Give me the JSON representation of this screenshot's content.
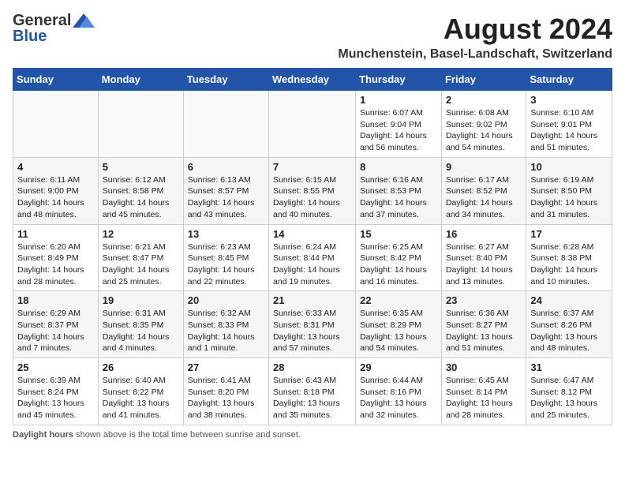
{
  "logo": {
    "general": "General",
    "blue": "Blue"
  },
  "title": "August 2024",
  "location": "Munchenstein, Basel-Landschaft, Switzerland",
  "days_of_week": [
    "Sunday",
    "Monday",
    "Tuesday",
    "Wednesday",
    "Thursday",
    "Friday",
    "Saturday"
  ],
  "footer": "Daylight hours",
  "weeks": [
    [
      {
        "day": "",
        "info": ""
      },
      {
        "day": "",
        "info": ""
      },
      {
        "day": "",
        "info": ""
      },
      {
        "day": "",
        "info": ""
      },
      {
        "day": "1",
        "info": "Sunrise: 6:07 AM\nSunset: 9:04 PM\nDaylight: 14 hours\nand 56 minutes."
      },
      {
        "day": "2",
        "info": "Sunrise: 6:08 AM\nSunset: 9:02 PM\nDaylight: 14 hours\nand 54 minutes."
      },
      {
        "day": "3",
        "info": "Sunrise: 6:10 AM\nSunset: 9:01 PM\nDaylight: 14 hours\nand 51 minutes."
      }
    ],
    [
      {
        "day": "4",
        "info": "Sunrise: 6:11 AM\nSunset: 9:00 PM\nDaylight: 14 hours\nand 48 minutes."
      },
      {
        "day": "5",
        "info": "Sunrise: 6:12 AM\nSunset: 8:58 PM\nDaylight: 14 hours\nand 45 minutes."
      },
      {
        "day": "6",
        "info": "Sunrise: 6:13 AM\nSunset: 8:57 PM\nDaylight: 14 hours\nand 43 minutes."
      },
      {
        "day": "7",
        "info": "Sunrise: 6:15 AM\nSunset: 8:55 PM\nDaylight: 14 hours\nand 40 minutes."
      },
      {
        "day": "8",
        "info": "Sunrise: 6:16 AM\nSunset: 8:53 PM\nDaylight: 14 hours\nand 37 minutes."
      },
      {
        "day": "9",
        "info": "Sunrise: 6:17 AM\nSunset: 8:52 PM\nDaylight: 14 hours\nand 34 minutes."
      },
      {
        "day": "10",
        "info": "Sunrise: 6:19 AM\nSunset: 8:50 PM\nDaylight: 14 hours\nand 31 minutes."
      }
    ],
    [
      {
        "day": "11",
        "info": "Sunrise: 6:20 AM\nSunset: 8:49 PM\nDaylight: 14 hours\nand 28 minutes."
      },
      {
        "day": "12",
        "info": "Sunrise: 6:21 AM\nSunset: 8:47 PM\nDaylight: 14 hours\nand 25 minutes."
      },
      {
        "day": "13",
        "info": "Sunrise: 6:23 AM\nSunset: 8:45 PM\nDaylight: 14 hours\nand 22 minutes."
      },
      {
        "day": "14",
        "info": "Sunrise: 6:24 AM\nSunset: 8:44 PM\nDaylight: 14 hours\nand 19 minutes."
      },
      {
        "day": "15",
        "info": "Sunrise: 6:25 AM\nSunset: 8:42 PM\nDaylight: 14 hours\nand 16 minutes."
      },
      {
        "day": "16",
        "info": "Sunrise: 6:27 AM\nSunset: 8:40 PM\nDaylight: 14 hours\nand 13 minutes."
      },
      {
        "day": "17",
        "info": "Sunrise: 6:28 AM\nSunset: 8:38 PM\nDaylight: 14 hours\nand 10 minutes."
      }
    ],
    [
      {
        "day": "18",
        "info": "Sunrise: 6:29 AM\nSunset: 8:37 PM\nDaylight: 14 hours\nand 7 minutes."
      },
      {
        "day": "19",
        "info": "Sunrise: 6:31 AM\nSunset: 8:35 PM\nDaylight: 14 hours\nand 4 minutes."
      },
      {
        "day": "20",
        "info": "Sunrise: 6:32 AM\nSunset: 8:33 PM\nDaylight: 14 hours\nand 1 minute."
      },
      {
        "day": "21",
        "info": "Sunrise: 6:33 AM\nSunset: 8:31 PM\nDaylight: 13 hours\nand 57 minutes."
      },
      {
        "day": "22",
        "info": "Sunrise: 6:35 AM\nSunset: 8:29 PM\nDaylight: 13 hours\nand 54 minutes."
      },
      {
        "day": "23",
        "info": "Sunrise: 6:36 AM\nSunset: 8:27 PM\nDaylight: 13 hours\nand 51 minutes."
      },
      {
        "day": "24",
        "info": "Sunrise: 6:37 AM\nSunset: 8:26 PM\nDaylight: 13 hours\nand 48 minutes."
      }
    ],
    [
      {
        "day": "25",
        "info": "Sunrise: 6:39 AM\nSunset: 8:24 PM\nDaylight: 13 hours\nand 45 minutes."
      },
      {
        "day": "26",
        "info": "Sunrise: 6:40 AM\nSunset: 8:22 PM\nDaylight: 13 hours\nand 41 minutes."
      },
      {
        "day": "27",
        "info": "Sunrise: 6:41 AM\nSunset: 8:20 PM\nDaylight: 13 hours\nand 38 minutes."
      },
      {
        "day": "28",
        "info": "Sunrise: 6:43 AM\nSunset: 8:18 PM\nDaylight: 13 hours\nand 35 minutes."
      },
      {
        "day": "29",
        "info": "Sunrise: 6:44 AM\nSunset: 8:16 PM\nDaylight: 13 hours\nand 32 minutes."
      },
      {
        "day": "30",
        "info": "Sunrise: 6:45 AM\nSunset: 8:14 PM\nDaylight: 13 hours\nand 28 minutes."
      },
      {
        "day": "31",
        "info": "Sunrise: 6:47 AM\nSunset: 8:12 PM\nDaylight: 13 hours\nand 25 minutes."
      }
    ]
  ]
}
